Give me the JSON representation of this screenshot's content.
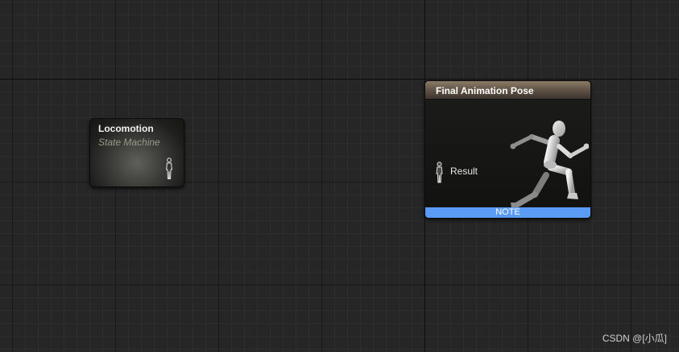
{
  "graph": {
    "state_machine_node": {
      "title": "Locomotion",
      "subtitle": "State Machine",
      "icon": "character-pose-icon"
    },
    "final_pose_node": {
      "title": "Final Animation Pose",
      "pin_label": "Result",
      "pin_icon": "character-pose-icon",
      "preview_icon": "running-mannequin-icon",
      "note_label": "NOTE",
      "header_color": "#6e6052",
      "note_color": "#5a9cf5"
    },
    "background_color": "#262626"
  },
  "watermark": "CSDN @[小瓜]"
}
